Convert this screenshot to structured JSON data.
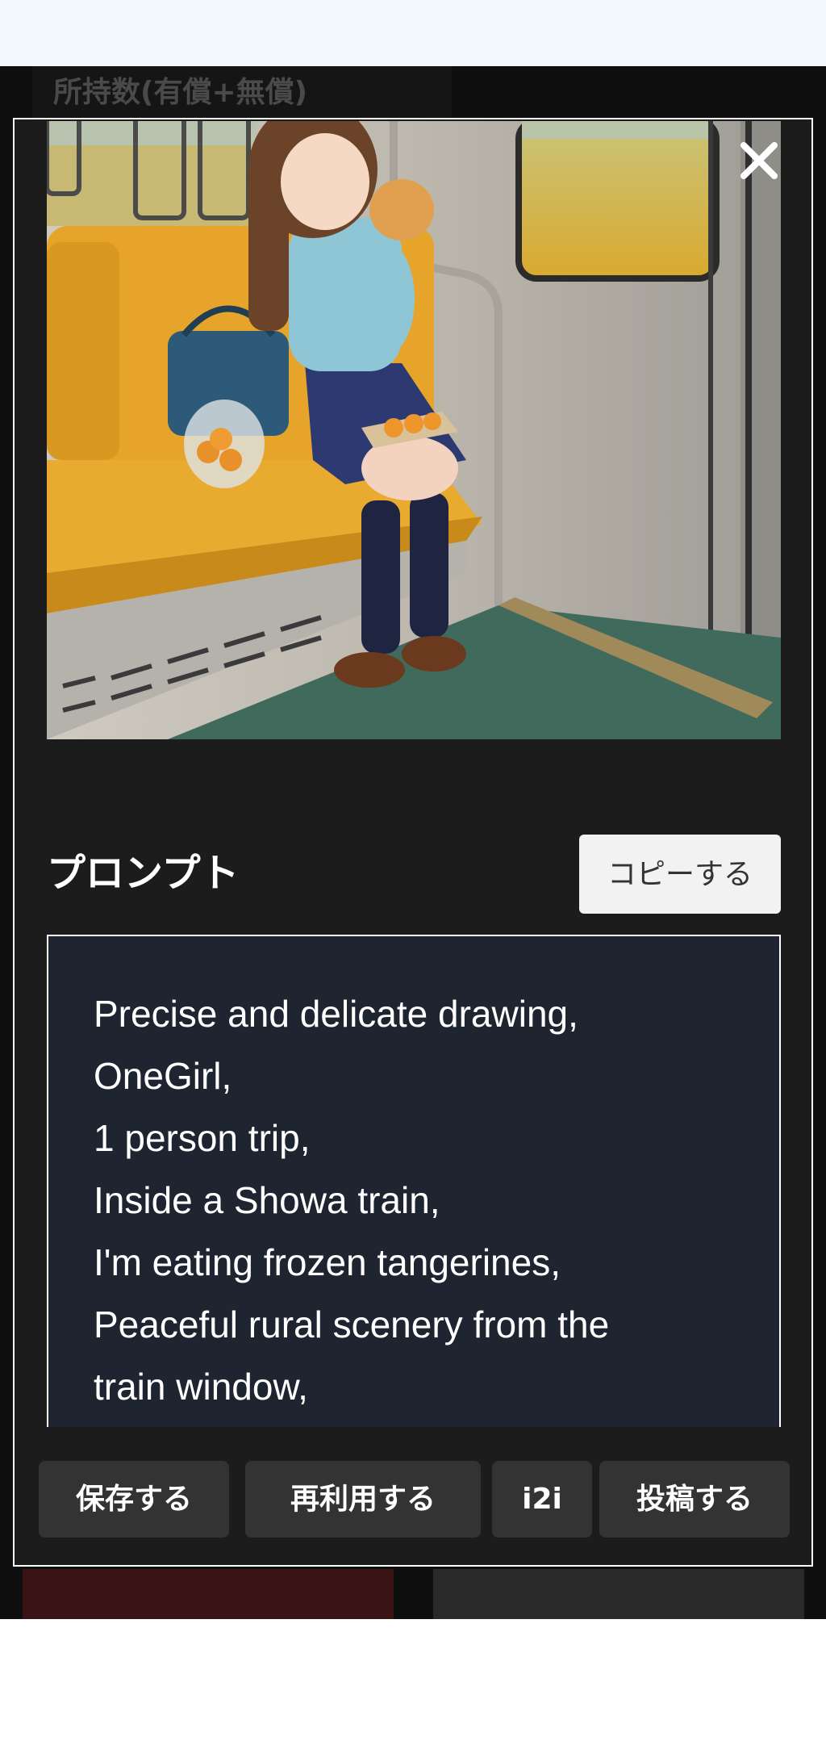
{
  "background": {
    "header_text": "所持数(有償+無償)"
  },
  "modal": {
    "image_alt": "Girl eating tangerines on a train",
    "close_label": "×",
    "prompt_section": {
      "title": "プロンプト",
      "copy_button": "コピーする",
      "text": "Precise and delicate drawing,\nOneGirl,\n1 person trip,\nInside a Showa train,\nI'm eating frozen tangerines,\nPeaceful rural scenery from the\ntrain window,"
    },
    "actions": {
      "save": "保存する",
      "reuse": "再利用する",
      "i2i": "i2i",
      "post": "投稿する"
    }
  },
  "colors": {
    "modal_bg": "#1c1c1c",
    "prompt_bg": "#1f2530",
    "button_bg": "#333333",
    "seat": "#e6a52a",
    "topbar": "#f1f8fb"
  },
  "icons": {
    "close": "close-icon"
  }
}
